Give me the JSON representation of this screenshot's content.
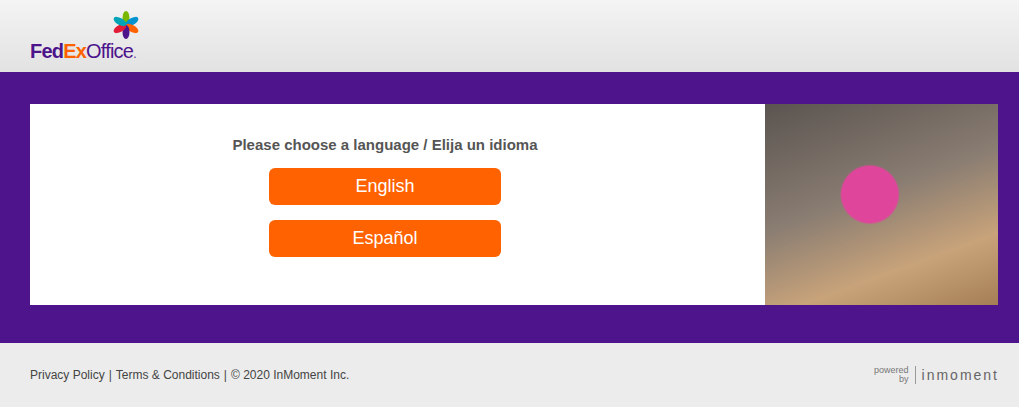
{
  "header": {
    "logo": {
      "fed": "Fed",
      "ex": "Ex",
      "office": "Office",
      "mark": "."
    }
  },
  "language_prompt": "Please choose a language / Elija un idioma",
  "languages": [
    {
      "label": "English"
    },
    {
      "label": "Español"
    }
  ],
  "footer": {
    "links": [
      "Privacy Policy",
      "Terms & Conditions",
      "© 2020 InMoment Inc."
    ],
    "separator": "|",
    "powered": {
      "top": "powered",
      "bottom": "by",
      "brand": "inmoment"
    }
  }
}
